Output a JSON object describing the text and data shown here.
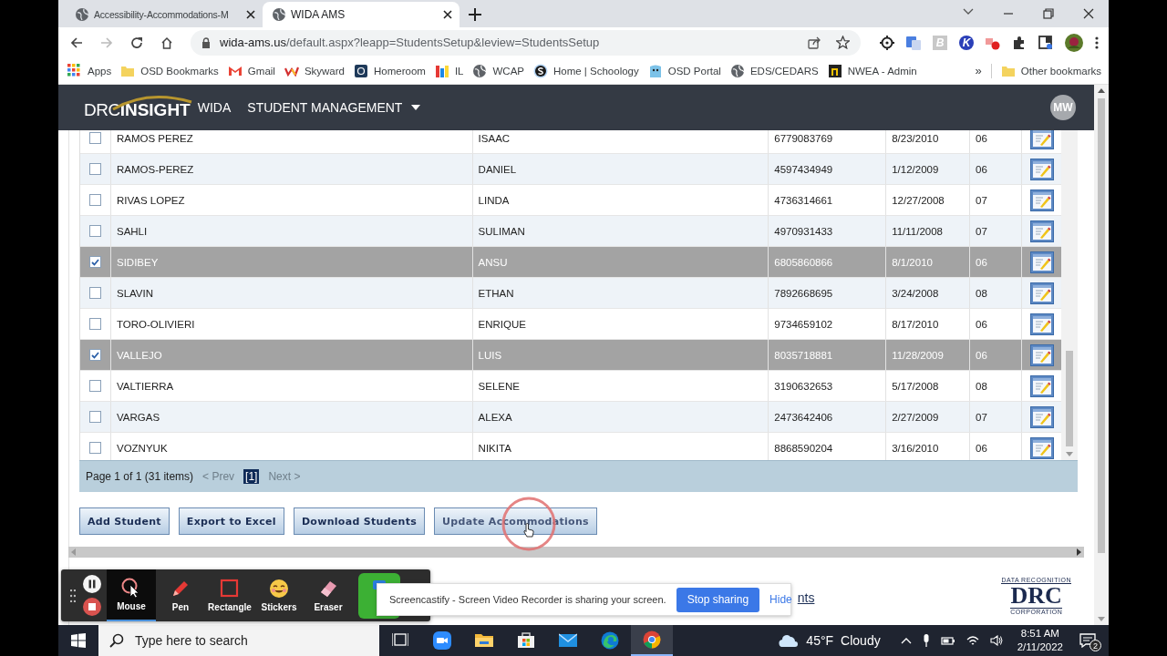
{
  "browser": {
    "tabs": [
      {
        "title": "Accessibility-Accommodations-M",
        "selected": false
      },
      {
        "title": "WIDA AMS",
        "selected": true
      }
    ],
    "url": {
      "host": "wida-ams.us",
      "path": "/default.aspx?leapp=StudentsSetup&leview=StudentsSetup"
    },
    "extensions": [
      {
        "kind": "target"
      },
      {
        "kind": "translate"
      },
      {
        "kind": "letter",
        "glyph": "B",
        "color": "#c8c8c8"
      },
      {
        "kind": "letter",
        "glyph": "K",
        "color": "#2a3fb8"
      },
      {
        "kind": "record"
      },
      {
        "kind": "puzzle"
      },
      {
        "kind": "sidebar"
      },
      {
        "kind": "profile"
      }
    ],
    "bookmarks": [
      {
        "label": "Apps",
        "kind": "apps"
      },
      {
        "label": "OSD Bookmarks",
        "kind": "folder"
      },
      {
        "label": "Gmail",
        "kind": "gmail"
      },
      {
        "label": "Skyward",
        "kind": "skyward"
      },
      {
        "label": "Homeroom",
        "kind": "homeroom"
      },
      {
        "label": "IL",
        "kind": "il"
      },
      {
        "label": "WCAP",
        "kind": "globe"
      },
      {
        "label": "Home | Schoology",
        "kind": "schoology"
      },
      {
        "label": "OSD Portal",
        "kind": "portal"
      },
      {
        "label": "EDS/CEDARS",
        "kind": "globe"
      },
      {
        "label": "NWEA - Admin",
        "kind": "nwea"
      }
    ],
    "overflow": "»",
    "other_bookmarks": "Other bookmarks"
  },
  "app_header": {
    "logo_left": "DRC",
    "logo_right": "INSIGHT",
    "program": "WIDA",
    "menu": "STUDENT MANAGEMENT",
    "avatar": "MW"
  },
  "table": {
    "rows": [
      {
        "checked": false,
        "last_name": "RAMOS PEREZ",
        "first_name": "ISAAC",
        "student_id": "6779083769",
        "birth_date": "8/23/2010",
        "grade": "06"
      },
      {
        "checked": false,
        "last_name": "RAMOS-PEREZ",
        "first_name": "DANIEL",
        "student_id": "4597434949",
        "birth_date": "1/12/2009",
        "grade": "06"
      },
      {
        "checked": false,
        "last_name": "RIVAS LOPEZ",
        "first_name": "LINDA",
        "student_id": "4736314661",
        "birth_date": "12/27/2008",
        "grade": "07"
      },
      {
        "checked": false,
        "last_name": "SAHLI",
        "first_name": "SULIMAN",
        "student_id": "4970931433",
        "birth_date": "11/11/2008",
        "grade": "07"
      },
      {
        "checked": true,
        "last_name": "SIDIBEY",
        "first_name": "ANSU",
        "student_id": "6805860866",
        "birth_date": "8/1/2010",
        "grade": "06"
      },
      {
        "checked": false,
        "last_name": "SLAVIN",
        "first_name": "ETHAN",
        "student_id": "7892668695",
        "birth_date": "3/24/2008",
        "grade": "08"
      },
      {
        "checked": false,
        "last_name": "TORO-OLIVIERI",
        "first_name": "ENRIQUE",
        "student_id": "9734659102",
        "birth_date": "8/17/2010",
        "grade": "06"
      },
      {
        "checked": true,
        "last_name": "VALLEJO",
        "first_name": "LUIS",
        "student_id": "8035718881",
        "birth_date": "11/28/2009",
        "grade": "06"
      },
      {
        "checked": false,
        "last_name": "VALTIERRA",
        "first_name": "SELENE",
        "student_id": "3190632653",
        "birth_date": "5/17/2008",
        "grade": "08"
      },
      {
        "checked": false,
        "last_name": "VARGAS",
        "first_name": "ALEXA",
        "student_id": "2473642406",
        "birth_date": "2/27/2009",
        "grade": "07"
      },
      {
        "checked": false,
        "last_name": "VOZNYUK",
        "first_name": "NIKITA",
        "student_id": "8868590204",
        "birth_date": "3/16/2010",
        "grade": "06"
      }
    ]
  },
  "pager": {
    "summary": "Page 1 of 1 (31 items)",
    "prev": "< Prev",
    "pages": [
      {
        "label": "[1]",
        "selected": true
      }
    ],
    "next": "Next >"
  },
  "buttons": [
    "Add Student",
    "Export to Excel",
    "Download Students",
    "Update Accommodations"
  ],
  "footer": {
    "link": "nts",
    "logo": {
      "top": "DATA RECOGNITION",
      "main": "DRC",
      "bottom": "CORPORATION"
    }
  },
  "recorder_toolbar": {
    "tools": [
      {
        "label": "Mouse",
        "kind": "mouse",
        "selected": true
      },
      {
        "label": "Pen",
        "kind": "pen",
        "selected": false
      },
      {
        "label": "Rectangle",
        "kind": "rectangle",
        "selected": false
      },
      {
        "label": "Stickers",
        "kind": "stickers",
        "selected": false
      },
      {
        "label": "Eraser",
        "kind": "eraser",
        "selected": false
      }
    ]
  },
  "share_notice": {
    "message": "Screencastify - Screen Video Recorder is sharing your screen.",
    "stop": "Stop sharing",
    "hide": "Hide"
  },
  "taskbar": {
    "search_placeholder": "Type here to search",
    "apps": [
      {
        "kind": "taskview",
        "active": false
      },
      {
        "kind": "zoom",
        "active": false
      },
      {
        "kind": "explorer",
        "active": false
      },
      {
        "kind": "store",
        "active": false
      },
      {
        "kind": "mail",
        "active": false
      },
      {
        "kind": "edge",
        "active": false
      },
      {
        "kind": "chrome",
        "active": true
      }
    ],
    "weather": {
      "temp": "45°F",
      "condition": "Cloudy"
    },
    "time": "8:51 AM",
    "date": "2/11/2022",
    "notifications": "2"
  }
}
